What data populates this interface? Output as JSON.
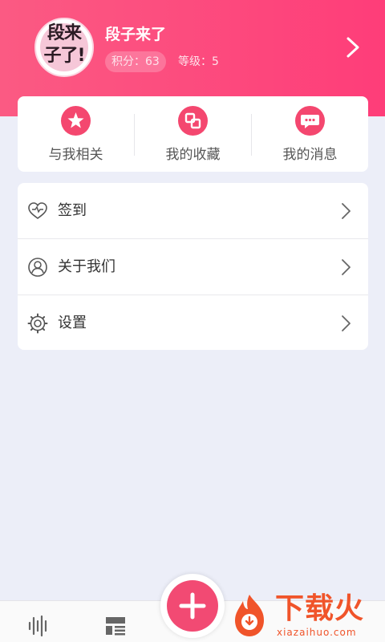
{
  "profile": {
    "avatar_text": [
      "段来",
      "子了!"
    ],
    "name": "段子来了",
    "points_label": "积分：63",
    "level_label": "等级：5"
  },
  "quick_actions": [
    {
      "label": "与我相关",
      "icon": "star-icon"
    },
    {
      "label": "我的收藏",
      "icon": "collection-icon"
    },
    {
      "label": "我的消息",
      "icon": "message-icon"
    }
  ],
  "menu": [
    {
      "label": "签到",
      "icon": "heart-icon"
    },
    {
      "label": "关于我们",
      "icon": "user-circle-icon"
    },
    {
      "label": "设置",
      "icon": "gear-icon"
    }
  ],
  "bottom_nav": {
    "tabs": [
      {
        "icon": "audio-wave-icon"
      },
      {
        "icon": "layout-icon"
      }
    ],
    "fab_icon": "plus-icon"
  },
  "watermark": {
    "text": "下载火",
    "url": "xiazaihuo.com"
  },
  "colors": {
    "accent": "#f4476f",
    "header_start": "#fb5a83",
    "header_end": "#fe3d79",
    "background": "#eceef8",
    "watermark": "#f0542a"
  }
}
